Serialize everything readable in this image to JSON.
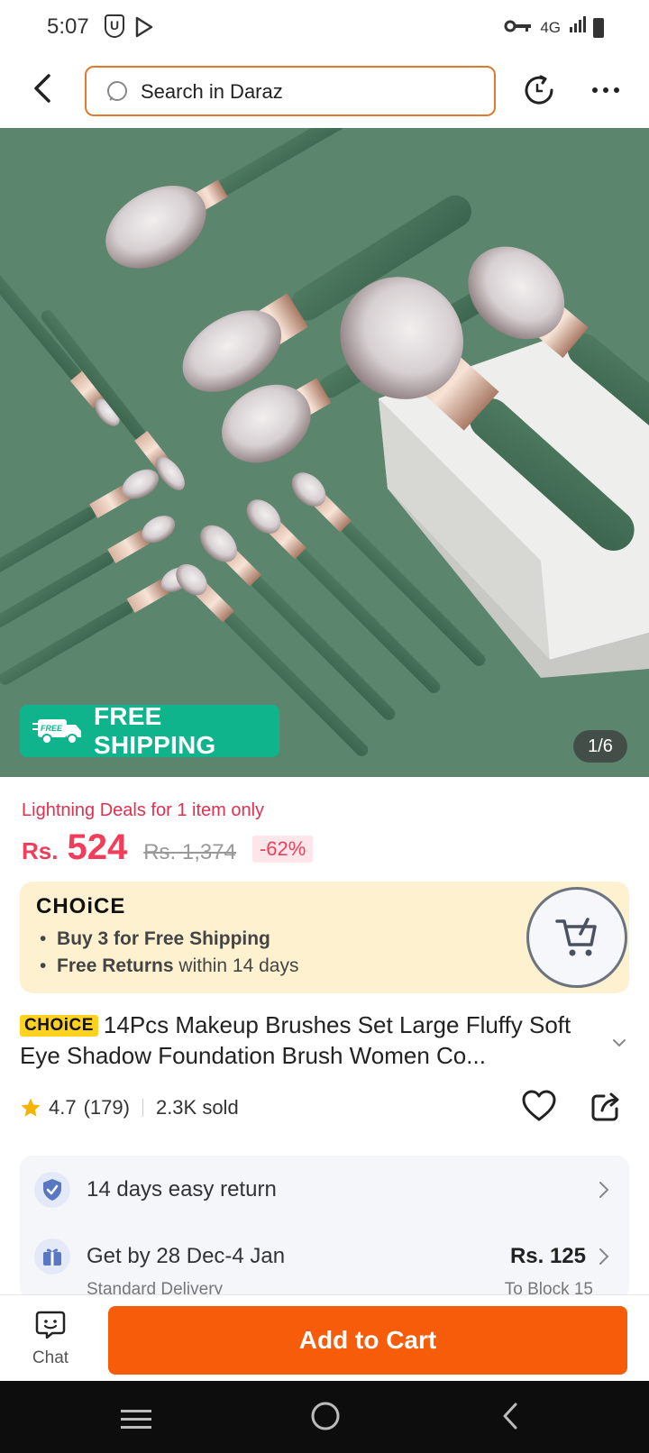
{
  "status_bar": {
    "time": "5:07",
    "network": "4G"
  },
  "header": {
    "search_placeholder": "Search in Daraz"
  },
  "hero": {
    "free_shipping_badge": "FREE",
    "free_shipping_label": "FREE SHIPPING",
    "image_counter": "1/6"
  },
  "price": {
    "deal_label": "Lightning Deals for 1 item only",
    "currency": "Rs.",
    "current": "524",
    "original": "Rs. 1,374",
    "discount": "-62%"
  },
  "choice": {
    "logo": "CHOiCE",
    "line1_bold": "Buy 3 for  Free Shipping",
    "line2_bold": "Free Returns",
    "line2_rest": " within 14 days"
  },
  "product": {
    "badge": "CHOiCE",
    "title": "14Pcs Makeup Brushes Set Large Fluffy Soft Eye Shadow Foundation Brush Women Co..."
  },
  "rating": {
    "score": "4.7",
    "count": "(179)",
    "sold": "2.3K sold"
  },
  "services": {
    "return_text": "14 days easy return",
    "delivery_text": "Get by 28 Dec-4 Jan",
    "delivery_price": "Rs. 125",
    "delivery_sub": "Standard Delivery",
    "delivery_to": "To Block 15"
  },
  "actions": {
    "chat": "Chat",
    "add_to_cart": "Add to Cart"
  },
  "colors": {
    "accent": "#f75c0b",
    "price": "#f23d5a",
    "free_shipping": "#0fb48d",
    "choice_bg": "#fdf1cf"
  }
}
